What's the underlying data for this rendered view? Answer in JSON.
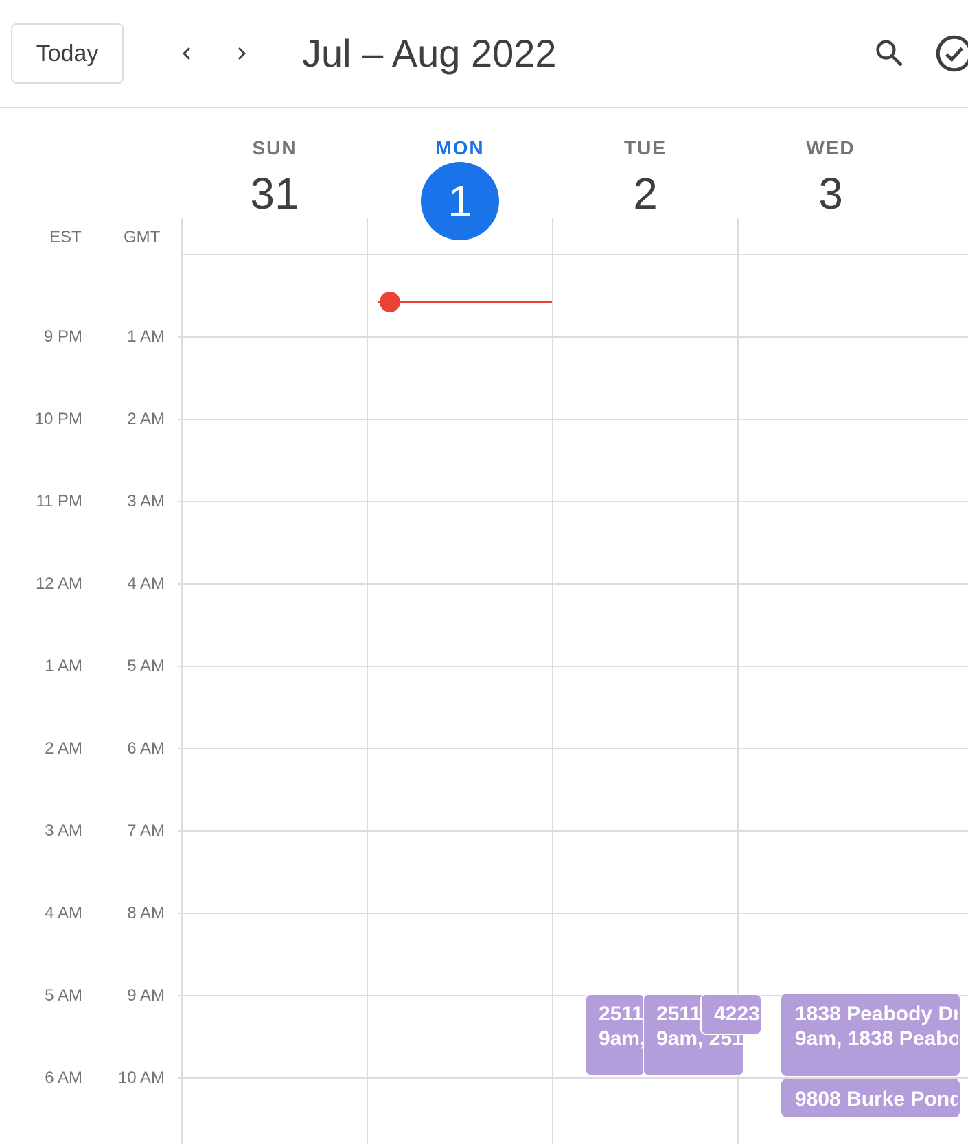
{
  "header": {
    "today_label": "Today",
    "range_title": "Jul – Aug 2022"
  },
  "days": [
    {
      "name": "SUN",
      "num": "31"
    },
    {
      "name": "MON",
      "num": "1"
    },
    {
      "name": "TUE",
      "num": "2"
    },
    {
      "name": "WED",
      "num": "3"
    }
  ],
  "timezones": {
    "primary": "EST",
    "secondary": "GMT"
  },
  "hours_est": [
    "9 PM",
    "10 PM",
    "11 PM",
    "12 AM",
    "1 AM",
    "2 AM",
    "3 AM",
    "4 AM",
    "5 AM",
    "6 AM"
  ],
  "hours_gmt": [
    "1 AM",
    "2 AM",
    "3 AM",
    "4 AM",
    "5 AM",
    "6 AM",
    "7 AM",
    "8 AM",
    "9 AM",
    "10 AM"
  ],
  "events": {
    "tue_1": {
      "title": "2511",
      "sub": "9am,"
    },
    "tue_2": {
      "title": "2511",
      "sub": "9am, 251"
    },
    "tue_3": {
      "title": "4223",
      "sub": ""
    },
    "wed_1": {
      "title": "1838 Peabody Dr,",
      "sub": "9am, 1838 Peabo"
    },
    "wed_2": {
      "title": "9808 Burke Pond",
      "sub": ""
    }
  },
  "colors": {
    "accent": "#1a73e8",
    "now_indicator": "#ea4335",
    "event": "#b39ddb",
    "grid": "#dadce0"
  }
}
